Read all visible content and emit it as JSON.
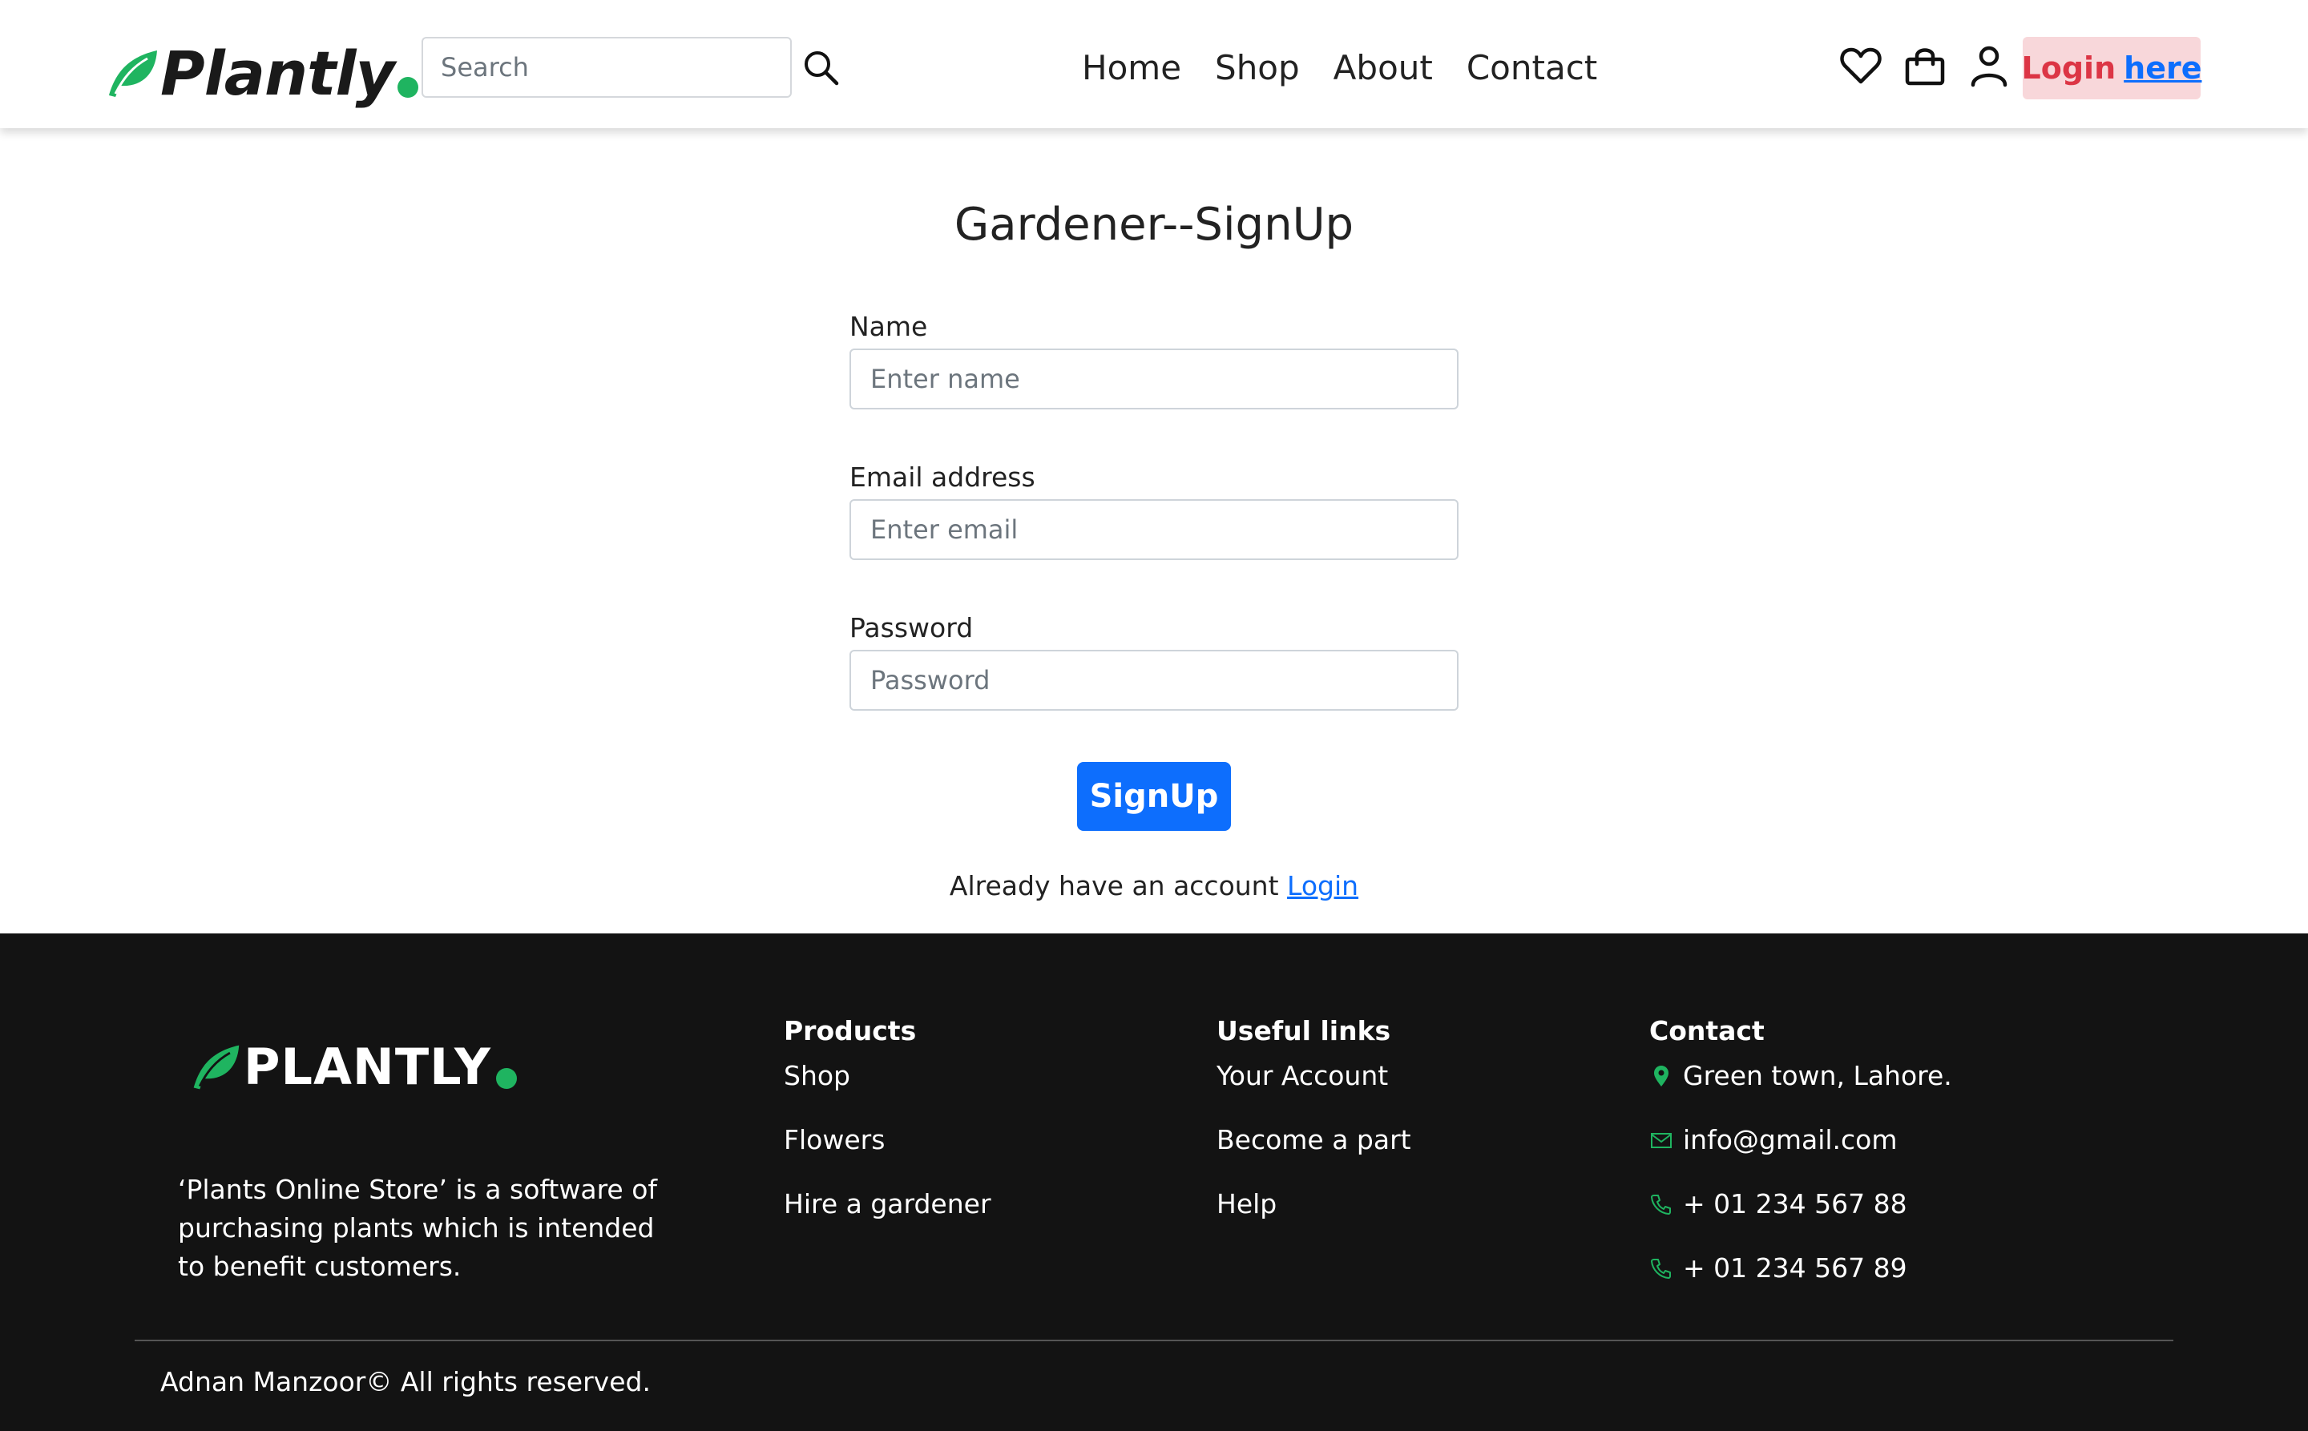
{
  "header": {
    "logo_text": "Plantly",
    "search_placeholder": "Search",
    "nav": [
      "Home",
      "Shop",
      "About",
      "Contact"
    ],
    "icons": [
      "heart-icon",
      "shopping-bag-icon",
      "user-icon"
    ],
    "login_label": "Login",
    "login_link": "here"
  },
  "form": {
    "title": "Gardener--SignUp",
    "name_label": "Name",
    "name_placeholder": "Enter name",
    "email_label": "Email address",
    "email_placeholder": "Enter email",
    "password_label": "Password",
    "password_placeholder": "Password",
    "submit_label": "SignUp",
    "already_text": "Already have an account",
    "login_link": "Login"
  },
  "footer": {
    "logo_text": "PLANTLY",
    "description": "‘Plants Online Store’ is a software of purchasing plants which is intended to benefit customers.",
    "columns": [
      {
        "title": "Products",
        "items": [
          "Shop",
          "Flowers",
          "Hire a gardener"
        ]
      },
      {
        "title": "Useful links",
        "items": [
          "Your Account",
          "Become a part",
          "Help"
        ]
      }
    ],
    "contact": {
      "title": "Contact",
      "address": "Green town, Lahore.",
      "email": "info@gmail.com",
      "phones": [
        "+ 01 234 567 88",
        "+ 01 234 567 89"
      ]
    },
    "copyright": "Adnan Manzoor© All rights reserved."
  },
  "colors": {
    "brand_green": "#1fb460",
    "primary_blue": "#0d6efd",
    "login_red": "#dc3545",
    "login_bg": "#f8d7da",
    "footer_bg": "#131313"
  }
}
